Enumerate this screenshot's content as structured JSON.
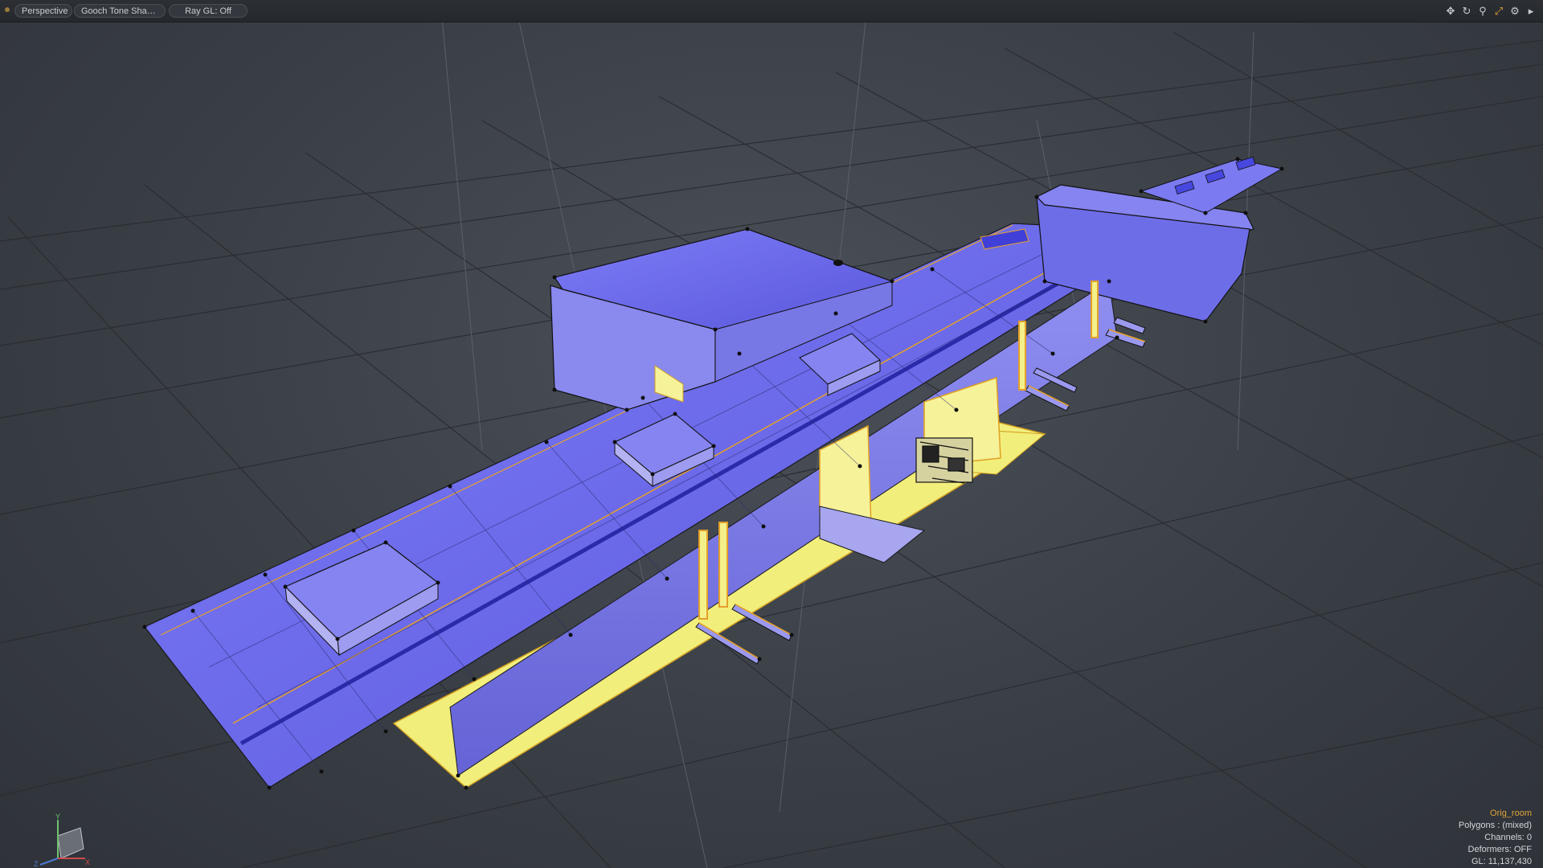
{
  "header": {
    "view_mode": "Perspective",
    "shading_mode": "Gooch Tone Shadin...",
    "ray_gl": "Ray GL: Off",
    "tools": [
      {
        "name": "move-view-icon",
        "glyph": "✥"
      },
      {
        "name": "rotate-view-icon",
        "glyph": "↻"
      },
      {
        "name": "zoom-view-icon",
        "glyph": "⚲"
      },
      {
        "name": "fit-view-icon",
        "glyph": "⤢"
      },
      {
        "name": "settings-icon",
        "glyph": "⚙"
      },
      {
        "name": "expand-arrow-icon",
        "glyph": "▸"
      }
    ]
  },
  "info": {
    "item_name": "Orig_room",
    "polygons": "Polygons : (mixed)",
    "channels": "Channels: 0",
    "deformers": "Deformers: OFF",
    "gl": "GL: 11,137,430"
  },
  "axis": {
    "x": "X",
    "y": "Y",
    "z": "Z"
  },
  "colors": {
    "background": "#3a3f46",
    "grid": "#2a2d32",
    "blue_surface": "#6f6ef2",
    "blue_dark": "#5654d6",
    "yellow_surface": "#f4f08a",
    "orange_edge": "#f0a020",
    "vertex": "#111111",
    "accent": "#e2a33a"
  }
}
